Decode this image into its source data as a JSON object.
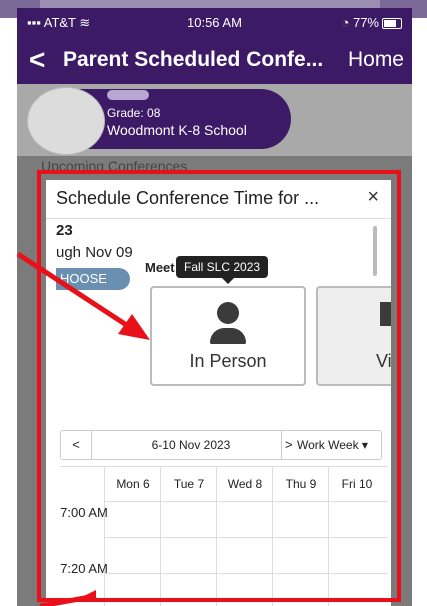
{
  "status": {
    "carrier": "AT&T",
    "time": "10:56 AM",
    "battery": "77%"
  },
  "nav": {
    "back_icon": "chevron-left-icon",
    "title": "Parent Scheduled Confe...",
    "home": "Home"
  },
  "student": {
    "grade": "Grade: 08",
    "school": "Woodmont K-8 School"
  },
  "section": {
    "label": "Upcoming Conferences"
  },
  "modal": {
    "title": "Schedule Conference Time for ...",
    "close": "×",
    "date_fragment": "23",
    "range_fragment": "ugh Nov 09",
    "choose": "HOOSE",
    "meet_label": "Meet",
    "tooltip": "Fall SLC 2023",
    "in_person": "In Person",
    "virtual": "Vi"
  },
  "calendar": {
    "prev": "<",
    "range": "6-10 Nov 2023",
    "next": ">",
    "view": "Work Week ▾",
    "days": [
      "Mon 6",
      "Tue 7",
      "Wed 8",
      "Thu 9",
      "Fri 10"
    ],
    "times": [
      "7:00 AM",
      "7:20 AM"
    ]
  },
  "colors": {
    "nav": "#3d1a66",
    "annotation": "#e8111a"
  }
}
